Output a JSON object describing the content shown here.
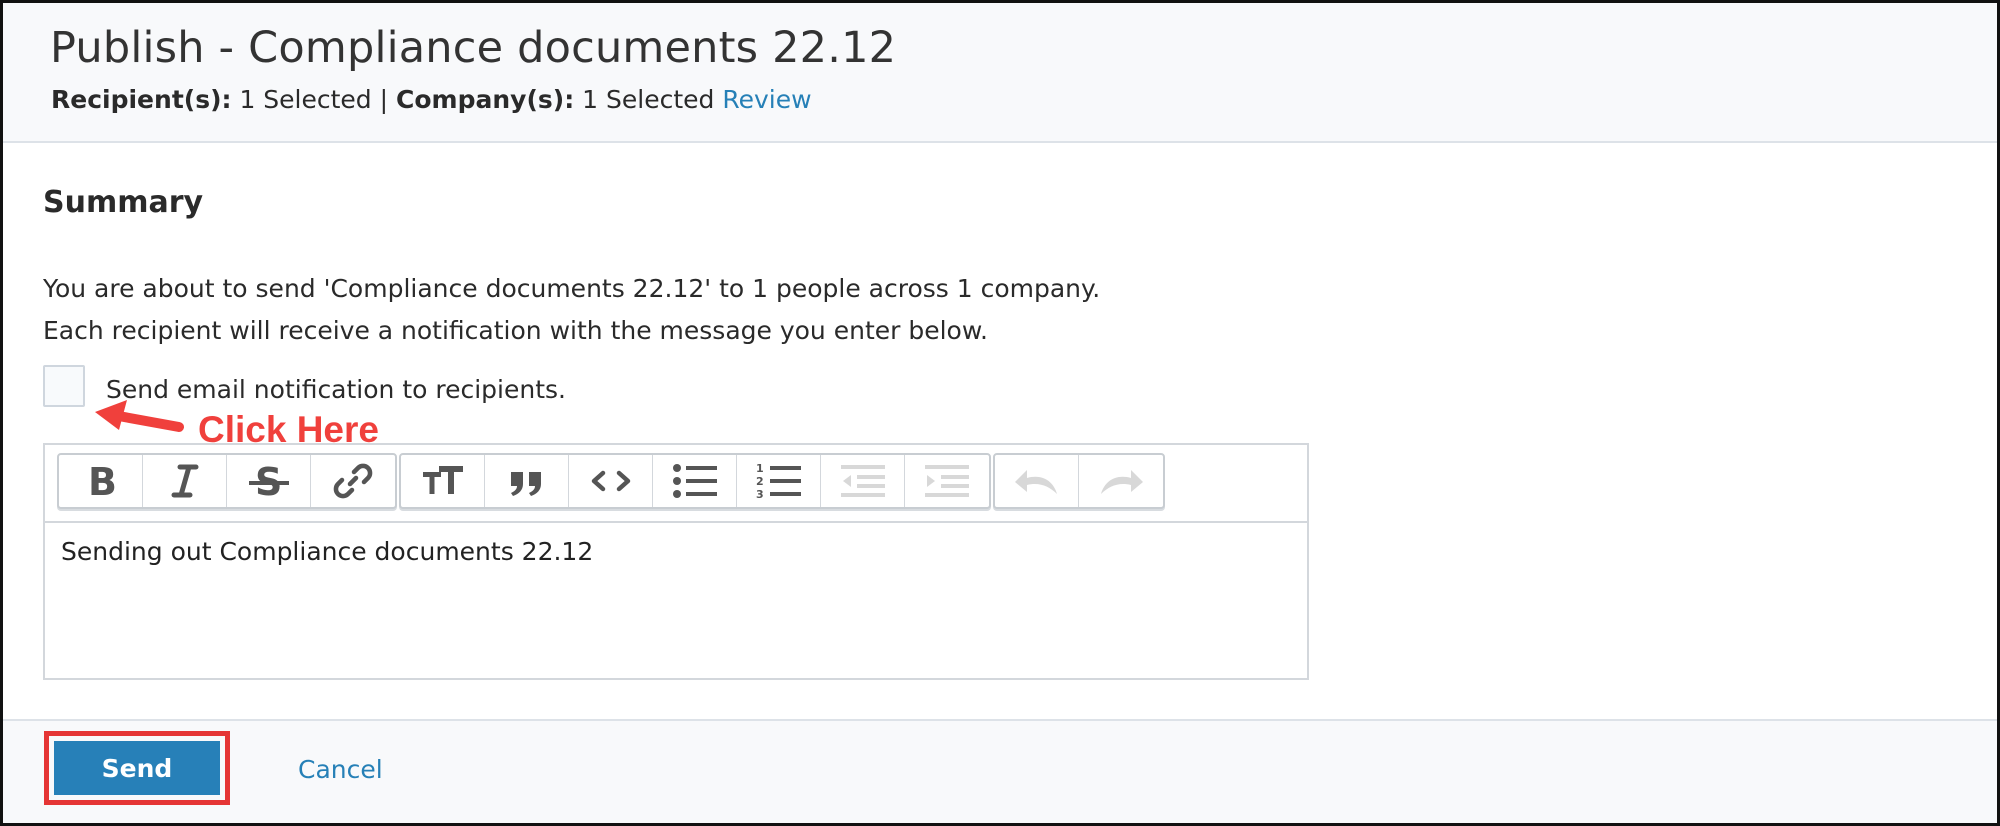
{
  "header": {
    "title": "Publish - Compliance documents 22.12",
    "recipients_label": "Recipient(s):",
    "recipients_value": "1 Selected",
    "separator": "|",
    "companies_label": "Company(s):",
    "companies_value": "1 Selected",
    "review_link": "Review"
  },
  "summary": {
    "heading": "Summary",
    "line1": "You are about to send 'Compliance documents 22.12' to 1 people across 1 company.",
    "line2": "Each recipient will receive a notification with the message you enter below."
  },
  "email_notification": {
    "label": "Send email notification to recipients.",
    "checked": false
  },
  "annotation": {
    "text": "Click Here",
    "color": "#f0403c"
  },
  "editor": {
    "toolbar": [
      {
        "icon": "bold-icon"
      },
      {
        "icon": "italic-icon"
      },
      {
        "icon": "strikethrough-icon"
      },
      {
        "icon": "link-icon"
      },
      {
        "icon": "heading-icon"
      },
      {
        "icon": "quote-icon"
      },
      {
        "icon": "code-icon"
      },
      {
        "icon": "bullet-list-icon"
      },
      {
        "icon": "numbered-list-icon"
      },
      {
        "icon": "decrease-indent-icon"
      },
      {
        "icon": "increase-indent-icon"
      },
      {
        "icon": "undo-icon"
      },
      {
        "icon": "redo-icon"
      }
    ],
    "content": "Sending out Compliance documents 22.12"
  },
  "footer": {
    "send_label": "Send",
    "cancel_label": "Cancel"
  },
  "colors": {
    "accent": "#2780b8",
    "link": "#2680b7",
    "highlight": "#e53535"
  }
}
